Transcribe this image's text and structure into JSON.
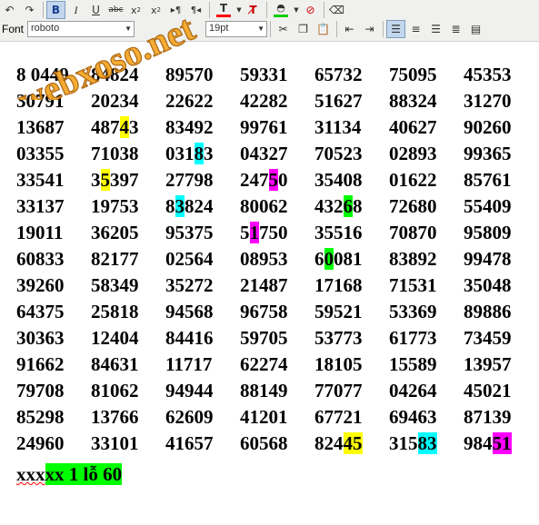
{
  "toolbar": {
    "font_label": "Font",
    "font_family_value": "roboto",
    "font_size_value": "19pt",
    "text_color": "#ff0000",
    "highlight_color": "#00cc00"
  },
  "watermark": {
    "text": "webxoso.net",
    "color": "#f5a623"
  },
  "highlight_colors": {
    "yellow": "#ffff00",
    "cyan": "#00ffff",
    "magenta": "#ff00ff",
    "green": "#00ff00"
  },
  "grid_rows": [
    [
      [
        "8",
        "",
        "0449"
      ],
      [
        "84824"
      ],
      [
        "89570"
      ],
      [
        "59331"
      ],
      [
        "65732"
      ],
      [
        "75095"
      ],
      [
        "45353"
      ]
    ],
    [
      [
        "30791"
      ],
      [
        "20234"
      ],
      [
        "22622"
      ],
      [
        "42282"
      ],
      [
        "51627"
      ],
      [
        "88324"
      ],
      [
        "31270"
      ]
    ],
    [
      [
        "13687"
      ],
      [
        "487",
        "yellow",
        "4",
        "3"
      ],
      [
        "83492"
      ],
      [
        "99761"
      ],
      [
        "31134"
      ],
      [
        "40627"
      ],
      [
        "90260"
      ]
    ],
    [
      [
        "03355"
      ],
      [
        "71038"
      ],
      [
        "031",
        "cyan",
        "8",
        "3"
      ],
      [
        "04327"
      ],
      [
        "70523"
      ],
      [
        "02893"
      ],
      [
        "99365"
      ]
    ],
    [
      [
        "33541"
      ],
      [
        "3",
        "yellow",
        "5",
        "397"
      ],
      [
        "27798"
      ],
      [
        "247",
        "magenta",
        "5",
        "0"
      ],
      [
        "35408"
      ],
      [
        "01622"
      ],
      [
        "85761"
      ]
    ],
    [
      [
        "33137"
      ],
      [
        "19753"
      ],
      [
        "8",
        "cyan",
        "3",
        "824"
      ],
      [
        "80062"
      ],
      [
        "432",
        "green",
        "6",
        "8"
      ],
      [
        "72680"
      ],
      [
        "55409"
      ]
    ],
    [
      [
        "19011"
      ],
      [
        "36205"
      ],
      [
        "95375"
      ],
      [
        "5",
        "magenta",
        "1",
        "750"
      ],
      [
        "35516"
      ],
      [
        "70870"
      ],
      [
        "95809"
      ]
    ],
    [
      [
        "60833"
      ],
      [
        "82177"
      ],
      [
        "02564"
      ],
      [
        "08953"
      ],
      [
        "6",
        "green",
        "0",
        "081"
      ],
      [
        "83892"
      ],
      [
        "99478"
      ]
    ],
    [
      [
        "39260"
      ],
      [
        "58349"
      ],
      [
        "35272"
      ],
      [
        "21487"
      ],
      [
        "17168"
      ],
      [
        "71531"
      ],
      [
        "35048"
      ]
    ],
    [
      [
        "64375"
      ],
      [
        "25818"
      ],
      [
        "94568"
      ],
      [
        "96758"
      ],
      [
        "59521"
      ],
      [
        "53369"
      ],
      [
        "89886"
      ]
    ],
    [
      [
        "30363"
      ],
      [
        "12404"
      ],
      [
        "84416"
      ],
      [
        "59705"
      ],
      [
        "53773"
      ],
      [
        "61773"
      ],
      [
        "73459"
      ]
    ],
    [
      [
        "91662"
      ],
      [
        "84631"
      ],
      [
        "11717"
      ],
      [
        "62274"
      ],
      [
        "18105"
      ],
      [
        "15589"
      ],
      [
        "13957"
      ]
    ],
    [
      [
        "79708"
      ],
      [
        "81062"
      ],
      [
        "94944"
      ],
      [
        "88149"
      ],
      [
        "77077"
      ],
      [
        "04264"
      ],
      [
        "45021"
      ]
    ],
    [
      [
        "85298"
      ],
      [
        "13766"
      ],
      [
        "62609"
      ],
      [
        "41201"
      ],
      [
        "67721"
      ],
      [
        "69463"
      ],
      [
        "87139"
      ]
    ],
    [
      [
        "24960"
      ],
      [
        "33101"
      ],
      [
        "41657"
      ],
      [
        "60568"
      ],
      [
        "824",
        "yellow",
        "45",
        ""
      ],
      [
        "315",
        "cyan",
        "83",
        ""
      ],
      [
        "984",
        "magenta",
        "51",
        ""
      ]
    ]
  ],
  "footer": {
    "plain_text": "xxx",
    "highlighted_text": "xx 1 lỗ 60"
  }
}
